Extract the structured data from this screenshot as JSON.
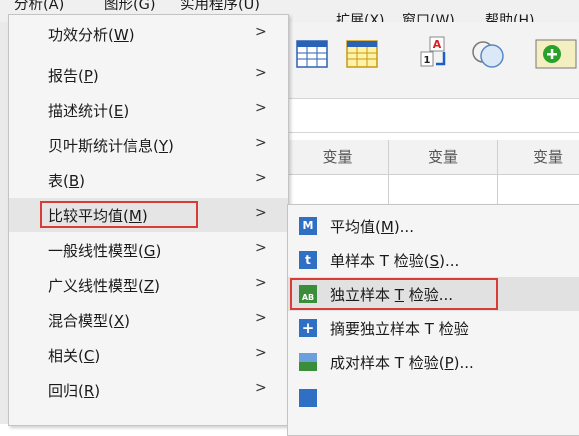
{
  "menubar": {
    "items": [
      "分析(A)",
      "图形(G)",
      "实用程序(U)",
      "扩展(X)",
      "窗口(W)",
      "帮助(H)"
    ]
  },
  "grid": {
    "headers": [
      "变量",
      "变量",
      "变量"
    ]
  },
  "analyze_menu": {
    "items": [
      {
        "label": "功效分析(",
        "mnemonic": "W",
        "suffix": ")"
      },
      {
        "label": "报告(",
        "mnemonic": "P",
        "suffix": ")"
      },
      {
        "label": "描述统计(",
        "mnemonic": "E",
        "suffix": ")"
      },
      {
        "label": "贝叶斯统计信息(",
        "mnemonic": "Y",
        "suffix": ")"
      },
      {
        "label": "表(",
        "mnemonic": "B",
        "suffix": ")"
      },
      {
        "label": "比较平均值(",
        "mnemonic": "M",
        "suffix": ")"
      },
      {
        "label": "一般线性模型(",
        "mnemonic": "G",
        "suffix": ")"
      },
      {
        "label": "广义线性模型(",
        "mnemonic": "Z",
        "suffix": ")"
      },
      {
        "label": "混合模型(",
        "mnemonic": "X",
        "suffix": ")"
      },
      {
        "label": "相关(",
        "mnemonic": "C",
        "suffix": ")"
      },
      {
        "label": "回归(",
        "mnemonic": "R",
        "suffix": ")"
      }
    ],
    "arrow": ">"
  },
  "compare_means_submenu": {
    "items": [
      {
        "label": "平均值(",
        "mnemonic": "M",
        "suffix": ")...",
        "icon": "means-icon",
        "icon_text": "M"
      },
      {
        "label": "单样本 T 检验(",
        "mnemonic": "S",
        "suffix": ")...",
        "icon": "one-sample-t-icon",
        "icon_text": "t"
      },
      {
        "label": "独立样本 ",
        "mnemonic": "T",
        "suffix": " 检验...",
        "icon": "independent-t-icon",
        "icon_text": "AB"
      },
      {
        "label": "摘要独立样本 T 检验",
        "mnemonic": "",
        "suffix": "",
        "icon": "summary-t-icon",
        "icon_text": "+"
      },
      {
        "label": "成对样本 T 检验(",
        "mnemonic": "P",
        "suffix": ")...",
        "icon": "paired-t-icon",
        "icon_text": ""
      }
    ]
  },
  "colors": {
    "highlight_border": "#d93b36",
    "menu_bg": "#f5f5f5",
    "hover_bg": "#e5e5e5"
  }
}
